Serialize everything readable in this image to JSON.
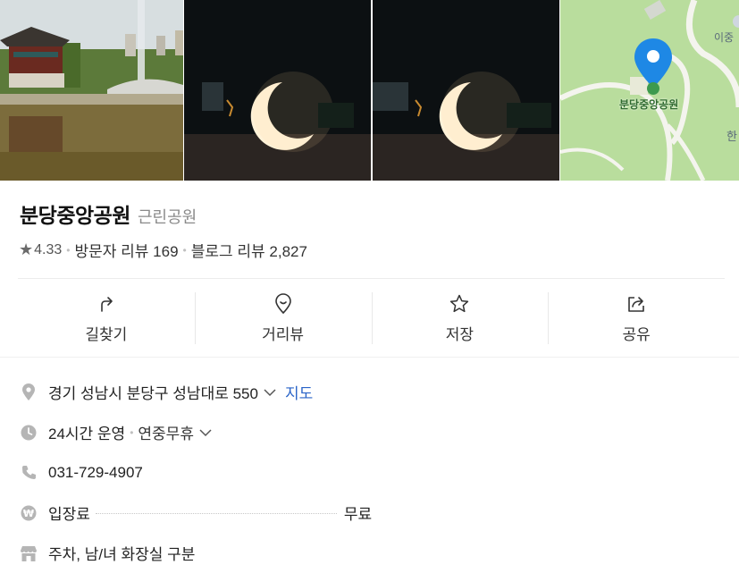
{
  "place": {
    "name": "분당중앙공원",
    "category": "근린공원",
    "rating": "4.33",
    "visitor_review_label": "방문자 리뷰",
    "visitor_review_count": "169",
    "blog_review_label": "블로그 리뷰",
    "blog_review_count": "2,827"
  },
  "photos": [
    {
      "icon": "park-pavilion-photo"
    },
    {
      "icon": "moon-sculpture-night-photo"
    },
    {
      "icon": "moon-sculpture-night-photo"
    },
    {
      "icon": "map-thumbnail"
    }
  ],
  "map_thumb": {
    "pin_label": "분당중앙공원",
    "edge_text_top": "이중",
    "edge_text_right": "한"
  },
  "actions": [
    {
      "label": "길찾기",
      "icon": "directions-icon"
    },
    {
      "label": "거리뷰",
      "icon": "street-view-icon"
    },
    {
      "label": "저장",
      "icon": "star-icon"
    },
    {
      "label": "공유",
      "icon": "share-icon"
    }
  ],
  "info": {
    "address": "경기 성남시 분당구 성남대로 550",
    "map_link": "지도",
    "hours": "24시간 운영",
    "hours_note": "연중무휴",
    "phone": "031-729-4907",
    "fee_label": "입장료",
    "fee_value": "무료",
    "amenities": "주차, 남/녀 화장실 구분"
  },
  "colors": {
    "accent_blue": "#2a64c8",
    "map_green": "#b9dd9d",
    "pin_blue": "#1e88e5"
  }
}
